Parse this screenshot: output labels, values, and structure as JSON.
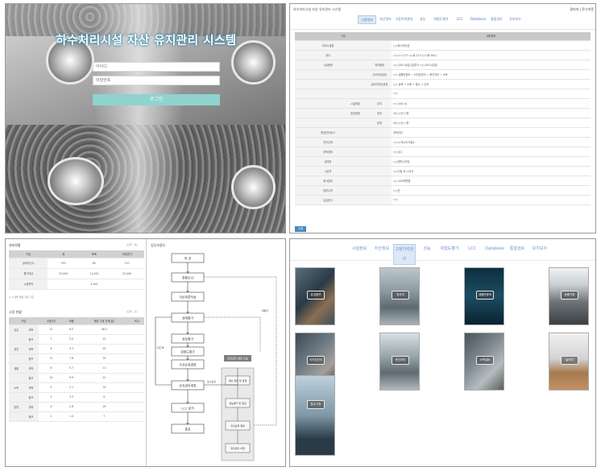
{
  "login": {
    "title": "하수처리시설 자산 유지관리 시스템",
    "id_placeholder": "아이디",
    "pw_placeholder": "비밀번호",
    "button": "로그인"
  },
  "detail": {
    "app_title": "하수처리시설 자산 유지관리 시스템",
    "user_info": "관리자 | 로그아웃",
    "nav": [
      "시설정보",
      "자산정보",
      "고장이력관리",
      "성능",
      "위험도평가",
      "LCC",
      "Database",
      "통합검토",
      "유지보수"
    ],
    "nav_active": 0,
    "table_header": [
      "구분",
      "세부항목"
    ],
    "rows": [
      [
        "",
        "처리시설명",
        "",
        "",
        "○○하수처리장"
      ],
      [
        "",
        "위치",
        "",
        "",
        "○○시 ○○구 ○○로 123 (○○동 000)"
      ],
      [
        "",
        "시설용량",
        "",
        "처리용량",
        "○○,000 ㎥/일 (분류식 ○○,000 ㎥/일)"
      ],
      [
        "",
        "",
        "",
        "주요처리공정",
        "○○ 생물반응조 → 이차침전지 → 총인처리 → 소독"
      ],
      [
        "",
        "",
        "",
        "슬러지처리공정",
        "○○ 농축 → 소화 → 탈수 → 건조"
      ],
      [
        "",
        "",
        "",
        "",
        "○○"
      ],
      [
        "",
        "",
        "시설현황",
        "부지",
        "○○,000 ㎡"
      ],
      [
        "",
        "",
        "준공현황",
        "준공",
        "20○○년 ○월"
      ],
      [
        "",
        "",
        "",
        "운영",
        "20○○년 ○월"
      ],
      [
        "",
        "운영관리방식",
        "",
        "",
        "위탁관리"
      ],
      [
        "",
        "관리주체",
        "",
        "",
        "○○시 하수도사업소"
      ],
      [
        "",
        "위탁업체",
        "",
        "",
        "○○(주)"
      ],
      [
        "",
        "설계자",
        "",
        "",
        "○○엔지니어링"
      ],
      [
        "",
        "시공자",
        "",
        "",
        "○○건설 외 ○개사"
      ],
      [
        "",
        "총사업비",
        "",
        "",
        "○○,000백만원"
      ],
      [
        "",
        "방류수역",
        "",
        "",
        "○○천"
      ],
      [
        "",
        "유입방식",
        "",
        "",
        "○○"
      ]
    ],
    "button": "수정"
  },
  "flow": {
    "left_title": "설비현황",
    "left_sub": "(단위 : 개)",
    "table1_header": [
      "구분",
      "계",
      "토목",
      "기계/전기"
    ],
    "table1_rows": [
      [
        "설비자산수",
        "793",
        "83",
        "710"
      ],
      [
        "평가대상",
        "33,000",
        "11,000",
        "22,000"
      ],
      [
        "시설면적",
        "",
        "4,100",
        ""
      ]
    ],
    "note": "※ 시설물 현황 자료 기준",
    "table2_title": "고장 현황",
    "table2_sub": "(단위 : 건)",
    "table2_header": [
      "구분",
      "고장건수",
      "비율",
      "평균 고장 간격(일)",
      "비고"
    ],
    "table2_rows": [
      [
        "유입",
        "계측",
        "12",
        "8.5",
        "48.3"
      ],
      [
        "",
        "펌프",
        "7",
        "5.0",
        "12"
      ],
      [
        "침전",
        "계측",
        "6",
        "4.3",
        "15"
      ],
      [
        "",
        "펌프",
        "11",
        "7.8",
        "10"
      ],
      [
        "생물",
        "계측",
        "8",
        "5.7",
        "11"
      ],
      [
        "",
        "펌프",
        "14",
        "9.9",
        "22"
      ],
      [
        "소독",
        "계측",
        "3",
        "2.1",
        "14"
      ],
      [
        "",
        "펌프",
        "5",
        "3.5",
        "9"
      ],
      [
        "방류",
        "계측",
        "4",
        "2.8",
        "19"
      ],
      [
        "",
        "펌프",
        "2",
        "1.4",
        "7"
      ]
    ],
    "right_title": "업무흐름도",
    "steps": [
      "착 공",
      "현황조사",
      "자산목록작성",
      "상태평가",
      "성능평가",
      "위험도평가",
      "우선순위결정",
      "유지관리계획",
      "LCC 분석",
      "종료"
    ],
    "side_header": "유지관리 계획 수립",
    "side_steps": [
      "예산 편성 및 집행",
      "성능평가 및 점검",
      "우선순위 결정",
      "유지관리 이행"
    ],
    "loop_label_1": "피드백",
    "loop_label_2": "재평가",
    "loop_label_3": "보수보강"
  },
  "gallery": {
    "nav": [
      "시설정보",
      "자산정보",
      "고장이력관리",
      "성능",
      "위험도평가",
      "LCC",
      "Database",
      "통합검토",
      "유지보수"
    ],
    "nav_active": 2,
    "tiles": [
      "유입펌프",
      "침사지",
      "생물반응조",
      "송풍기동",
      "이차침전지",
      "총인처리",
      "소독설비",
      "슬러지",
      "탈수기동"
    ]
  }
}
